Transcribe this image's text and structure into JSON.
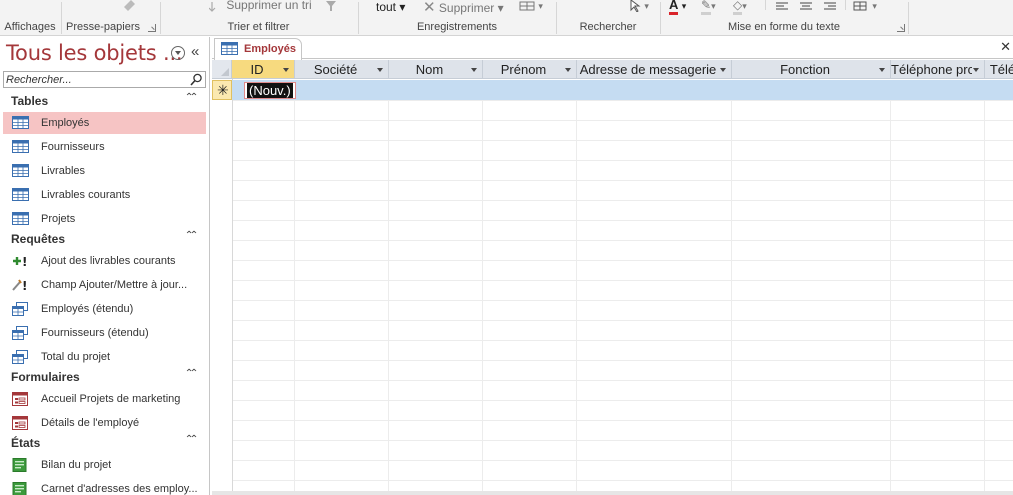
{
  "ribbon": {
    "groups": [
      {
        "label": "Affichages"
      },
      {
        "label": "Presse-papiers"
      },
      {
        "label": "Trier et filtrer"
      },
      {
        "label": "Enregistrements"
      },
      {
        "label": "Rechercher"
      },
      {
        "label": "Mise en forme du texte"
      }
    ],
    "clipped_buttons": {
      "remove_sort": "Supprimer un tri",
      "refresh_all": "tout",
      "delete": "Supprimer"
    }
  },
  "nav_pane": {
    "title": "Tous les objets ...",
    "search_placeholder": "Rechercher...",
    "sections": [
      {
        "title": "Tables",
        "items": [
          {
            "label": "Employés",
            "icon": "table-icon",
            "selected": true
          },
          {
            "label": "Fournisseurs",
            "icon": "table-icon"
          },
          {
            "label": "Livrables",
            "icon": "table-icon"
          },
          {
            "label": "Livrables courants",
            "icon": "table-icon"
          },
          {
            "label": "Projets",
            "icon": "table-icon"
          }
        ]
      },
      {
        "title": "Requêtes",
        "items": [
          {
            "label": "Ajout des livrables courants",
            "icon": "append-query-icon"
          },
          {
            "label": "Champ Ajouter/Mettre à jour...",
            "icon": "update-query-icon"
          },
          {
            "label": "Employés (étendu)",
            "icon": "select-query-icon"
          },
          {
            "label": "Fournisseurs (étendu)",
            "icon": "select-query-icon"
          },
          {
            "label": "Total du projet",
            "icon": "select-query-icon"
          }
        ]
      },
      {
        "title": "Formulaires",
        "items": [
          {
            "label": "Accueil Projets de marketing",
            "icon": "form-icon"
          },
          {
            "label": "Détails de l'employé",
            "icon": "form-icon"
          }
        ]
      },
      {
        "title": "États",
        "items": [
          {
            "label": "Bilan du projet",
            "icon": "report-icon"
          },
          {
            "label": "Carnet d'adresses des employ...",
            "icon": "report-icon"
          }
        ]
      }
    ]
  },
  "document": {
    "tab_label": "Employés",
    "columns": [
      "ID",
      "Société",
      "Nom",
      "Prénom",
      "Adresse de messagerie",
      "Fonction",
      "Téléphone professionnel",
      "Télé"
    ],
    "new_record_marker": "✳",
    "new_record_value": "(Nouv.)"
  },
  "colors": {
    "accent": "#a4373a",
    "selected_item_bg": "#f6c4c4",
    "active_header": "#f7da7f",
    "new_row": "#c5dcf2"
  }
}
